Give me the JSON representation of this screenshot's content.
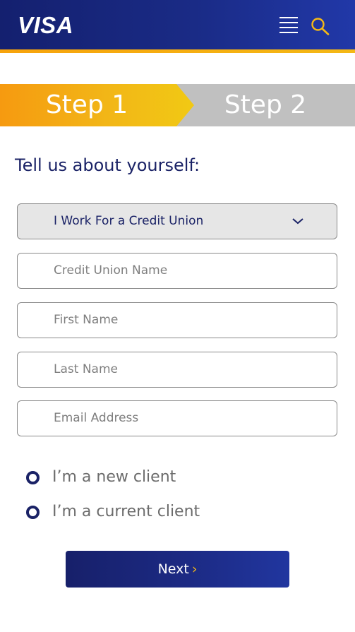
{
  "header": {
    "logo_text": "VISA",
    "menu_icon": "hamburger-menu-icon",
    "search_icon": "search-icon"
  },
  "steps": [
    {
      "label": "Step 1",
      "active": true
    },
    {
      "label": "Step 2",
      "active": false
    }
  ],
  "form": {
    "heading": "Tell us about yourself:",
    "org_type": {
      "selected": "I Work For a Credit Union",
      "icon": "chevron-down-icon"
    },
    "credit_union_name": {
      "placeholder": "Credit Union Name"
    },
    "first_name": {
      "placeholder": "First Name"
    },
    "last_name": {
      "placeholder": "Last Name"
    },
    "email": {
      "placeholder": "Email Address"
    },
    "client_type_options": [
      "I’m a new client",
      "I’m a current client"
    ]
  },
  "next_button": {
    "label": "Next",
    "arrow": "›"
  },
  "colors": {
    "brand_navy": "#1a2266",
    "brand_gold": "#f4b816",
    "step_inactive": "#c0c0c0"
  }
}
